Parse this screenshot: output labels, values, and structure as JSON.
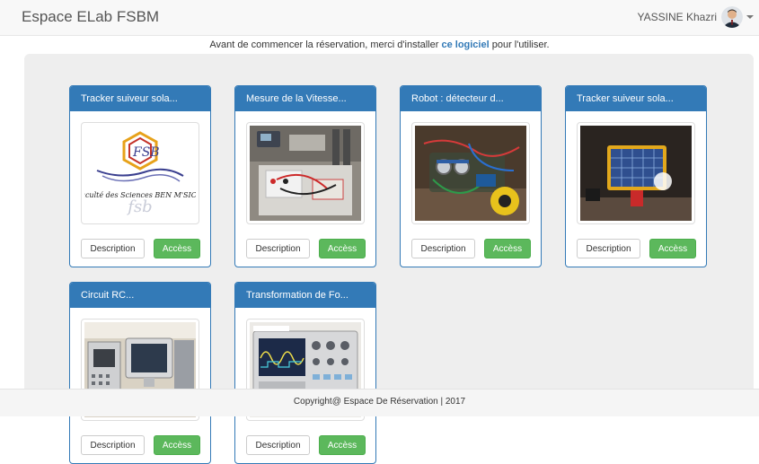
{
  "navbar": {
    "brand": "Espace ELab FSBM",
    "user_name": "YASSINE Khazri"
  },
  "notice": {
    "before": "Avant de commencer la réservation, merci d'installer ",
    "link": "ce logiciel",
    "after": " pour l'utiliser."
  },
  "cards": [
    {
      "title": "Tracker suiveur sola...",
      "image": "fsbm-logo",
      "image_text": "faculté des Sciences BEN M'SICK",
      "logo_mark": "FSB",
      "desc_label": "Description",
      "access_label": "Accèss"
    },
    {
      "title": "Mesure de la Vitesse...",
      "image": "lab-bench-photo",
      "desc_label": "Description",
      "access_label": "Accèss"
    },
    {
      "title": "Robot : détecteur d...",
      "image": "robot-photo",
      "desc_label": "Description",
      "access_label": "Accèss"
    },
    {
      "title": "Tracker suiveur sola...",
      "image": "solar-panel-photo",
      "desc_label": "Description",
      "access_label": "Accèss"
    },
    {
      "title": "Circuit RC...",
      "image": "computers-photo",
      "desc_label": "Description",
      "access_label": "Accèss"
    },
    {
      "title": "Transformation de Fo...",
      "image": "oscilloscope-photo",
      "desc_label": "Description",
      "access_label": "Accèss"
    }
  ],
  "footer": {
    "text": "Copyright@ Espace De Réservation | 2017"
  }
}
